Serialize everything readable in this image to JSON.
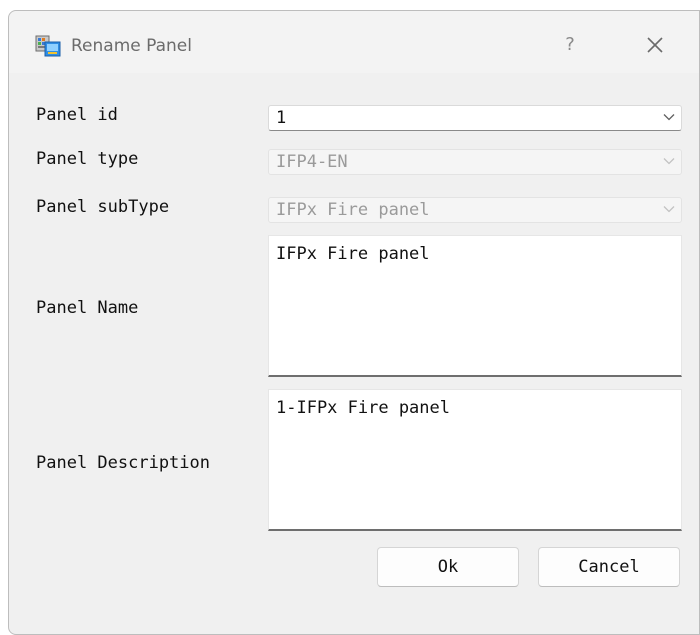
{
  "window": {
    "title": "Rename Panel",
    "help_label": "?",
    "app_icon": "panel-app-icon",
    "close_icon": "close-icon"
  },
  "form": {
    "panel_id": {
      "label": "Panel id",
      "value": "1",
      "enabled": true
    },
    "panel_type": {
      "label": "Panel type",
      "value": "IFP4-EN",
      "enabled": false
    },
    "panel_subtype": {
      "label": "Panel subType",
      "value": "IFPx Fire panel",
      "enabled": false
    },
    "panel_name": {
      "label": "Panel Name",
      "value": "IFPx Fire panel"
    },
    "panel_description": {
      "label": "Panel Description",
      "value": "1-IFPx Fire panel"
    }
  },
  "buttons": {
    "ok_label": "Ok",
    "cancel_label": "Cancel"
  },
  "colors": {
    "dialog_bg": "#f0f0f0",
    "disabled_text": "#9a9a9a",
    "title_text": "#6b6b6b"
  }
}
